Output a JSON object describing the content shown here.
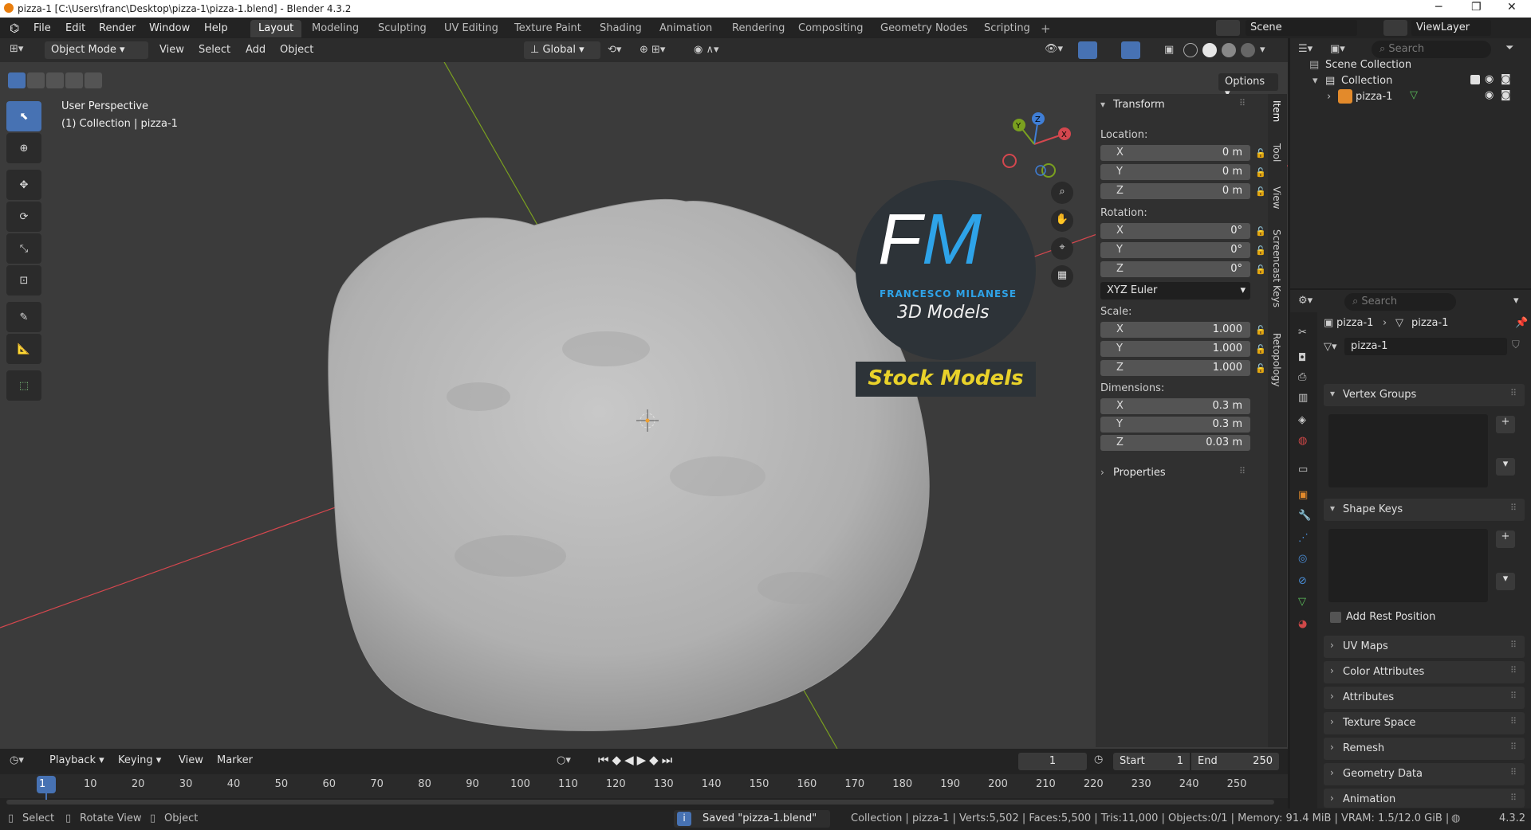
{
  "window": {
    "title": "pizza-1 [C:\\Users\\franc\\Desktop\\pizza-1\\pizza-1.blend] - Blender 4.3.2",
    "controls": [
      "─",
      "❐",
      "✕"
    ]
  },
  "menu": [
    "File",
    "Edit",
    "Render",
    "Window",
    "Help"
  ],
  "workspaces": [
    "Layout",
    "Modeling",
    "Sculpting",
    "UV Editing",
    "Texture Paint",
    "Shading",
    "Animation",
    "Rendering",
    "Compositing",
    "Geometry Nodes",
    "Scripting"
  ],
  "active_workspace": "Layout",
  "scene": {
    "name": "Scene",
    "view_layer": "ViewLayer"
  },
  "viewport_header": {
    "mode": "Object Mode",
    "menus": [
      "View",
      "Select",
      "Add",
      "Object"
    ],
    "orientation": "Global",
    "options_label": "Options"
  },
  "viewport": {
    "overlay_line1": "User Perspective",
    "overlay_line2": "(1) Collection | pizza-1",
    "logo_fm": "FM",
    "logo_name": "FRANCESCO MILANESE",
    "logo_sub": "3D Models",
    "logo_stock": "Stock Models",
    "gizmo_axes": {
      "x": "X",
      "y": "Y",
      "z": "Z"
    }
  },
  "npanel": {
    "section": "Transform",
    "location_label": "Location:",
    "location": [
      {
        "axis": "X",
        "value": "0 m"
      },
      {
        "axis": "Y",
        "value": "0 m"
      },
      {
        "axis": "Z",
        "value": "0 m"
      }
    ],
    "rotation_label": "Rotation:",
    "rotation": [
      {
        "axis": "X",
        "value": "0°"
      },
      {
        "axis": "Y",
        "value": "0°"
      },
      {
        "axis": "Z",
        "value": "0°"
      }
    ],
    "rotation_mode": "XYZ Euler",
    "scale_label": "Scale:",
    "scale": [
      {
        "axis": "X",
        "value": "1.000"
      },
      {
        "axis": "Y",
        "value": "1.000"
      },
      {
        "axis": "Z",
        "value": "1.000"
      }
    ],
    "dimensions_label": "Dimensions:",
    "dimensions": [
      {
        "axis": "X",
        "value": "0.3 m"
      },
      {
        "axis": "Y",
        "value": "0.3 m"
      },
      {
        "axis": "Z",
        "value": "0.03 m"
      }
    ],
    "properties": "Properties",
    "tabs": [
      "Item",
      "Tool",
      "View",
      "Screencast Keys",
      "Retopology"
    ]
  },
  "outliner": {
    "search_placeholder": "Search",
    "scene_collection": "Scene Collection",
    "collection": "Collection",
    "object": "pizza-1"
  },
  "properties": {
    "search_placeholder": "Search",
    "breadcrumb_object": "pizza-1",
    "breadcrumb_mesh": "pizza-1",
    "mesh_name": "pizza-1",
    "vertex_groups": "Vertex Groups",
    "shape_keys": "Shape Keys",
    "add_rest_position": "Add Rest Position",
    "sections": [
      "UV Maps",
      "Color Attributes",
      "Attributes",
      "Texture Space",
      "Remesh",
      "Geometry Data",
      "Animation"
    ]
  },
  "timeline": {
    "menus": [
      "Playback",
      "Keying",
      "View",
      "Marker"
    ],
    "current_frame": "1",
    "start_label": "Start",
    "start": "1",
    "end_label": "End",
    "end": "250",
    "ruler": [
      "1",
      "10",
      "20",
      "30",
      "40",
      "50",
      "60",
      "70",
      "80",
      "90",
      "100",
      "110",
      "120",
      "130",
      "140",
      "150",
      "160",
      "170",
      "180",
      "190",
      "200",
      "210",
      "220",
      "230",
      "240",
      "250"
    ]
  },
  "statusbar": {
    "select": "Select",
    "rotate_view": "Rotate View",
    "object": "Object",
    "message": "Saved \"pizza-1.blend\"",
    "stats": "Collection | pizza-1 | Verts:5,502 | Faces:5,500 | Tris:11,000 | Objects:0/1 | Memory: 91.4 MiB | VRAM: 1.5/12.0 GiB |",
    "version": "4.3.2"
  },
  "colors": {
    "accent": "#4772b3",
    "x_axis": "#d4474e",
    "y_axis": "#7aa01f",
    "z_axis": "#3f7ed6",
    "stock_text": "#e9d22a",
    "logo_blue": "#2ea3e8"
  }
}
